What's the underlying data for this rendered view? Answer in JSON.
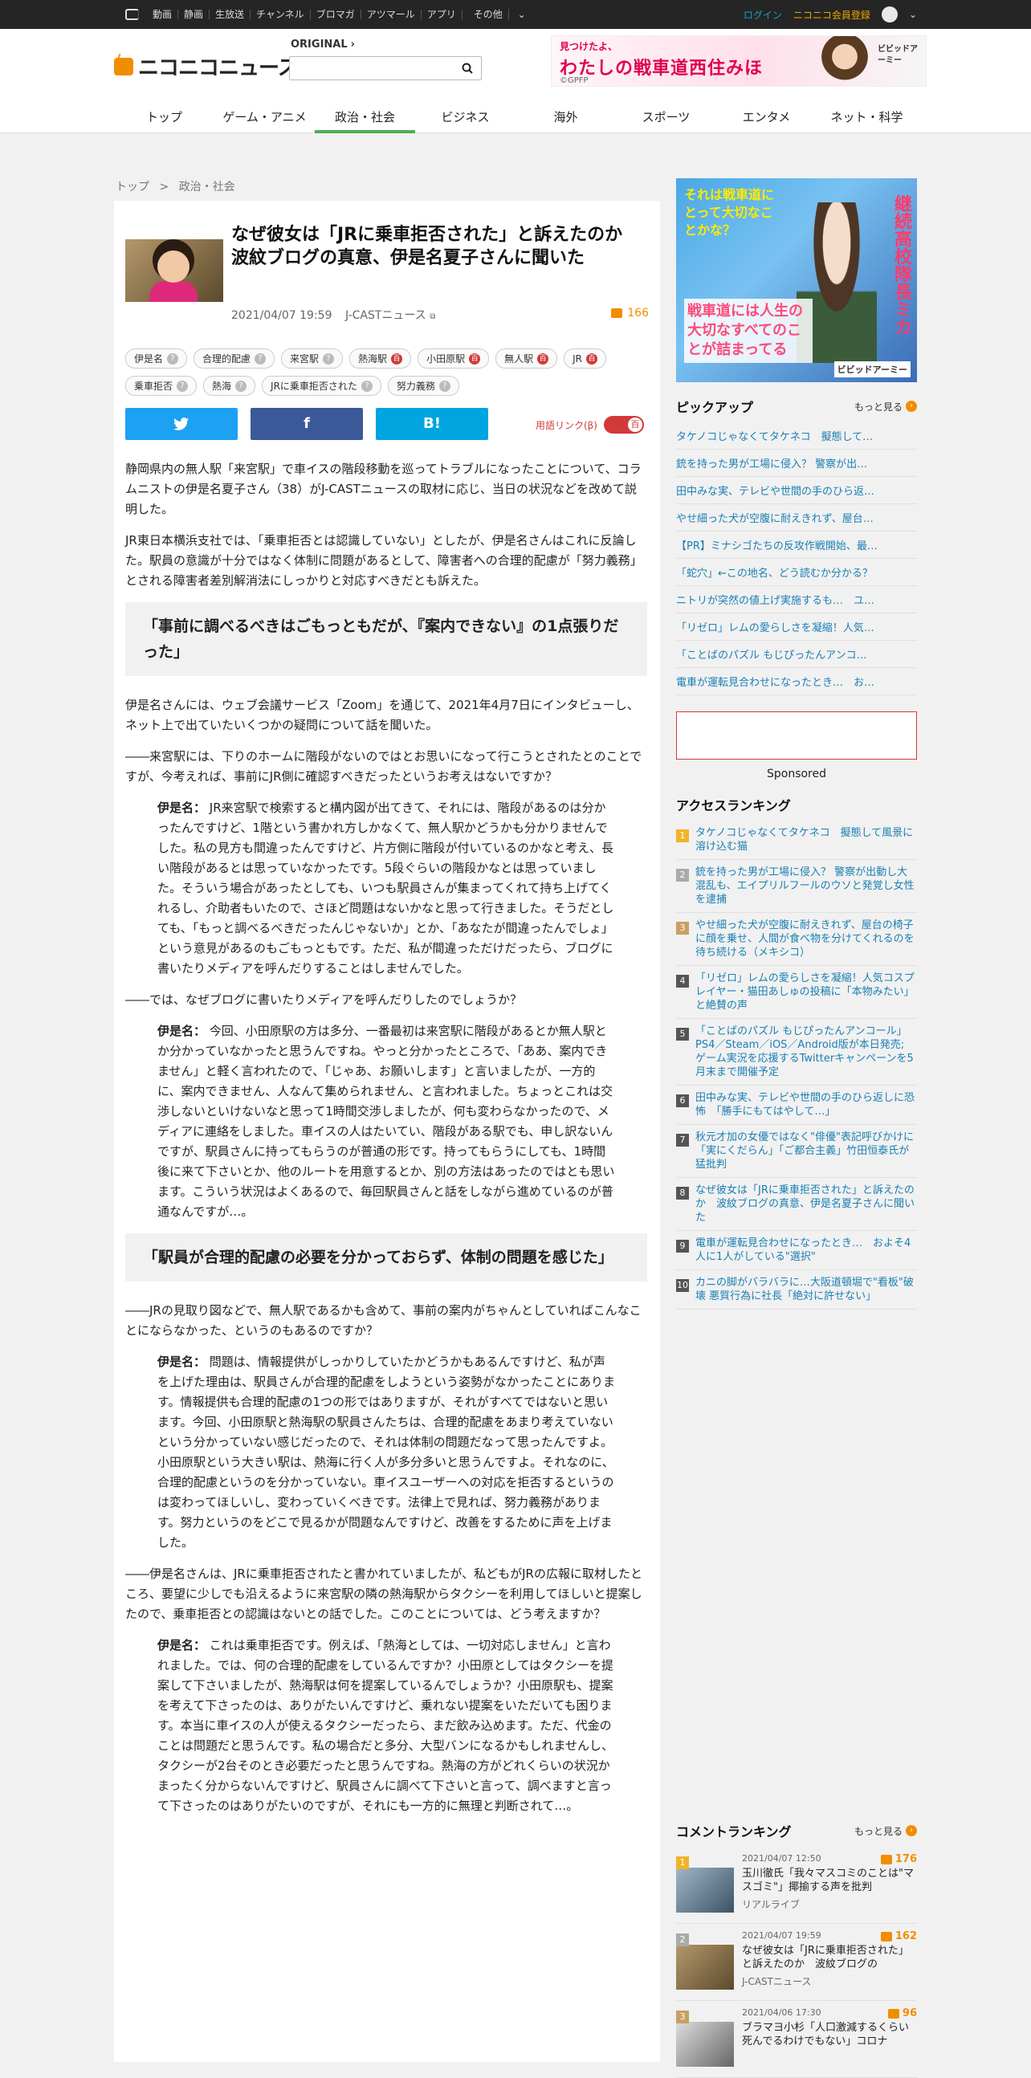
{
  "topbar": {
    "nav": [
      "動画",
      "静画",
      "生放送",
      "チャンネル",
      "ブロマガ",
      "アツマール",
      "アプリ",
      "その他"
    ],
    "login": "ログイン",
    "register": "ニコニコ会員登録"
  },
  "header": {
    "logo": "ニコニコニュース",
    "original_label": "ORIGINAL",
    "banner": {
      "line1": "見つけたよ、",
      "line2": "わたしの戦車道西住みほ",
      "line3": "©GPFP",
      "badge": "ビビッドアーミー"
    },
    "nav": [
      "トップ",
      "ゲーム・アニメ",
      "政治・社会",
      "ビジネス",
      "海外",
      "スポーツ",
      "エンタメ",
      "ネット・科学"
    ],
    "active_nav": "政治・社会"
  },
  "breadcrumb": {
    "home": "トップ",
    "sep": ">",
    "current": "政治・社会"
  },
  "article": {
    "title": "なぜ彼女は「JRに乗車拒否された」と訴えたのか　波紋ブログの真意、伊是名夏子さんに聞いた",
    "datetime": "2021/04/07 19:59",
    "source": "J-CASTニュース",
    "comment_count": "166",
    "tags": [
      {
        "label": "伊是名",
        "mark": "?"
      },
      {
        "label": "合理的配慮",
        "mark": "?"
      },
      {
        "label": "来宮駅",
        "mark": "?"
      },
      {
        "label": "熱海駅",
        "mark": "百"
      },
      {
        "label": "小田原駅",
        "mark": "百"
      },
      {
        "label": "無人駅",
        "mark": "百"
      },
      {
        "label": "JR",
        "mark": "百"
      },
      {
        "label": "乗車拒否",
        "mark": "?"
      },
      {
        "label": "熱海",
        "mark": "?"
      },
      {
        "label": "JRに乗車拒否された",
        "mark": "?"
      },
      {
        "label": "努力義務",
        "mark": "?"
      }
    ],
    "share": {
      "twitter": "twitter",
      "facebook": "f",
      "hatena": "B!"
    },
    "yougo_label": "用語リンク(β)",
    "paragraphs": [
      {
        "type": "p",
        "text": "静岡県内の無人駅「来宮駅」で車イスの階段移動を巡ってトラブルになったことについて、コラムニストの伊是名夏子さん（38）がJ-CASTニュースの取材に応じ、当日の状況などを改めて説明した。"
      },
      {
        "type": "p",
        "text": "JR東日本横浜支社では、「乗車拒否とは認識していない」としたが、伊是名さんはこれに反論した。駅員の意識が十分ではなく体制に問題があるとして、障害者への合理的配慮が「努力義務」とされる障害者差別解消法にしっかりと対応すべきだとも訴えた。"
      },
      {
        "type": "h",
        "text": "「事前に調べるべきはごもっともだが、『案内できない』の1点張りだった」"
      },
      {
        "type": "p",
        "text": "伊是名さんには、ウェブ会議サービス「Zoom」を通じて、2021年4月7日にインタビューし、ネット上で出ていたいくつかの疑問について話を聞いた。"
      },
      {
        "type": "p",
        "text": "――来宮駅には、下りのホームに階段がないのではとお思いになって行こうとされたとのことですが、今考えれば、事前にJR側に確認すべきだったというお考えはないですか？"
      },
      {
        "type": "q",
        "speaker": "伊是名：",
        "text": "JR来宮駅で検索すると構内図が出てきて、それには、階段があるのは分かったんですけど、1階という書かれ方しかなくて、無人駅かどうかも分かりませんでした。私の見方も間違ったんですけど、片方側に階段が付いているのかなと考え、長い階段があるとは思っていなかったです。5段ぐらいの階段かなとは思っていました。そういう場合があったとしても、いつも駅員さんが集まってくれて持ち上げてくれるし、介助者もいたので、さほど問題はないかなと思って行きました。そうだとしても、「もっと調べるべきだったんじゃないか」とか、「あなたが間違ったんでしょ」という意見があるのもごもっともです。ただ、私が間違っただけだったら、ブログに書いたりメディアを呼んだりすることはしませんでした。"
      },
      {
        "type": "p",
        "text": "――では、なぜブログに書いたりメディアを呼んだりしたのでしょうか？"
      },
      {
        "type": "q",
        "speaker": "伊是名：",
        "text": "今回、小田原駅の方は多分、一番最初は来宮駅に階段があるとか無人駅とか分かっていなかったと思うんですね。やっと分かったところで、「ああ、案内できません」と軽く言われたので、「じゃあ、お願いします」と言いましたが、一方的に、案内できません、人なんて集められません、と言われました。ちょっとこれは交渉しないといけないなと思って1時間交渉しましたが、何も変わらなかったので、メディアに連絡をしました。車イスの人はたいてい、階段がある駅でも、申し訳ないんですが、駅員さんに持ってもらうのが普通の形です。持ってもらうにしても、1時間後に来て下さいとか、他のルートを用意するとか、別の方法はあったのではとも思います。こういう状況はよくあるので、毎回駅員さんと話をしながら進めているのが普通なんですが…。"
      },
      {
        "type": "h",
        "text": "「駅員が合理的配慮の必要を分かっておらず、体制の問題を感じた」"
      },
      {
        "type": "p",
        "text": "――JRの見取り図などで、無人駅であるかも含めて、事前の案内がちゃんとしていればこんなことにならなかった、というのもあるのですか？"
      },
      {
        "type": "q",
        "speaker": "伊是名：",
        "text": "問題は、情報提供がしっかりしていたかどうかもあるんですけど、私が声を上げた理由は、駅員さんが合理的配慮をしようという姿勢がなかったことにあります。情報提供も合理的配慮の1つの形ではありますが、それがすべてではないと思います。今回、小田原駅と熱海駅の駅員さんたちは、合理的配慮をあまり考えていないという分かっていない感じだったので、それは体制の問題だなって思ったんですよ。小田原駅という大きい駅は、熱海に行く人が多分多いと思うんですよ。それなのに、合理的配慮というのを分かっていない。車イスユーザーへの対応を拒否するというのは変わってほしいし、変わっていくべきです。法律上で見れば、努力義務があります。努力というのをどこで見るかが問題なんですけど、改善をするために声を上げました。"
      },
      {
        "type": "p",
        "text": "――伊是名さんは、JRに乗車拒否されたと書かれていましたが、私どもがJRの広報に取材したところ、要望に少しでも沿えるように来宮駅の隣の熱海駅からタクシーを利用してほしいと提案したので、乗車拒否との認識はないとの話でした。このことについては、どう考えますか？"
      },
      {
        "type": "q",
        "speaker": "伊是名：",
        "text": "これは乗車拒否です。例えば、「熱海としては、一切対応しません」と言われました。では、何の合理的配慮をしているんですか？小田原としてはタクシーを提案して下さいましたが、熱海駅は何を提案しているんでしょうか？小田原駅も、提案を考えて下さったのは、ありがたいんですけど、乗れない提案をいただいても困ります。本当に車イスの人が使えるタクシーだったら、まだ飲み込めます。ただ、代金のことは問題だと思うんです。私の場合だと多分、大型バンになるかもしれませんし、タクシーが2台そのとき必要だったと思うんですね。熱海の方がどれくらいの状況かまったく分からないんですけど、駅員さんに調べて下さいと言って、調べますと言って下さったのはありがたいのですが、それにも一方的に無理と判断されて…。"
      }
    ]
  },
  "sidebar": {
    "ad": {
      "top": "それは戦車道にとって大切なことかな？",
      "bottom": "戦車道には人生の大切なすべてのことが詰まってる",
      "who": "継続高校隊長ミカ",
      "logo": "ビビッドアーミー"
    },
    "pickup": {
      "heading": "ピックアップ",
      "more": "もっと見る",
      "items": [
        "タケノコじゃなくてタケネコ　擬態して…",
        "銃を持った男が工場に侵入？ 警察が出…",
        "田中みな実、テレビや世間の手のひら返…",
        "やせ細った犬が空腹に耐えきれず、屋台…",
        "【PR】ミナシゴたちの反攻作戦開始、最…",
        "「蛇穴」←この地名、どう読むか分かる？",
        "ニトリが突然の値上げ実施するも…　ユ…",
        "「リゼロ」レムの愛らしさを凝縮！人気…",
        "「ことばのパズル もじぴったんアンコ…",
        "電車が運転見合わせになったとき…　お…"
      ]
    },
    "sponsored": "Sponsored",
    "access": {
      "heading": "アクセスランキング",
      "items": [
        "タケノコじゃなくてタケネコ　擬態して風景に溶け込む猫",
        "銃を持った男が工場に侵入？ 警察が出動し大混乱も、エイプリルフールのウソと発覚し女性を逮捕",
        "やせ細った犬が空腹に耐えきれず、屋台の椅子に顔を乗せ、人間が食べ物を分けてくれるのを待ち続ける（メキシコ）",
        "「リゼロ」レムの愛らしさを凝縮！人気コスプレイヤー・猫田あしゅの投稿に「本物みたい」と絶賛の声",
        "「ことばのパズル もじぴったんアンコール」PS4／Steam／iOS／Android版が本日発売; ゲーム実況を応援するTwitterキャンペーンを5月末まで開催予定",
        "田中みな実、テレビや世間の手のひら返しに恐怖　「勝手にもてはやして…」",
        "秋元才加の女優ではなく\"俳優\"表記呼びかけに「実にくだらん」「ご都合主義」竹田恒泰氏が猛批判",
        "なぜ彼女は「JRに乗車拒否された」と訴えたのか　波紋ブログの真意、伊是名夏子さんに聞いた",
        "電車が運転見合わせになったとき…　およそ4人に1人がしている\"選択\"",
        "カニの脚がバラバラに…大阪道頓堀で\"看板\"破壊 悪質行為に社長「絶対に許せない」"
      ]
    },
    "comment_ranking": {
      "heading": "コメントランキング",
      "more": "もっと見る",
      "items": [
        {
          "date": "2021/04/07 12:50",
          "count": "176",
          "title": "玉川徹氏「我々マスコミのことは\"マスゴミ\"」揶揄する声を批判",
          "source": "リアルライブ"
        },
        {
          "date": "2021/04/07 19:59",
          "count": "162",
          "title": "なぜ彼女は「JRに乗車拒否された」と訴えたのか　波紋ブログの",
          "source": "J-CASTニュース"
        },
        {
          "date": "2021/04/06 17:30",
          "count": "96",
          "title": "ブラマヨ小杉「人口激減するくらい死んでるわけでもない」コロナ",
          "source": ""
        }
      ]
    }
  }
}
